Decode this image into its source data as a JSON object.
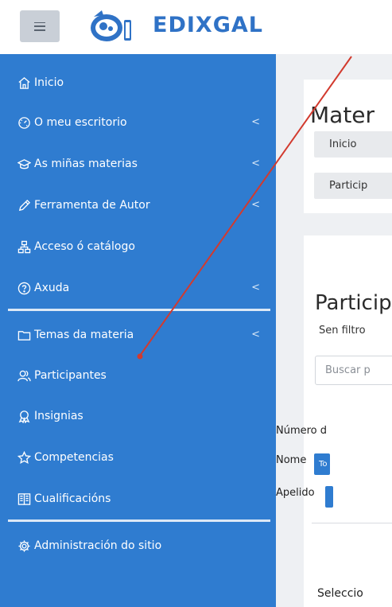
{
  "header": {
    "menu_icon": "hamburger-icon",
    "logo_icon": "edixgal-logo-icon",
    "logo_text": "EDIXGAL"
  },
  "sidebar": {
    "items": [
      {
        "label": "Inicio",
        "icon": "home-icon",
        "chevron": false
      },
      {
        "label": "O meu escritorio",
        "icon": "speedometer-icon",
        "chevron": true
      },
      {
        "label": "As miñas materias",
        "icon": "graduation-cap-icon",
        "chevron": true
      },
      {
        "label": "Ferramenta de Autor",
        "icon": "pencil-icon",
        "chevron": true
      },
      {
        "label": "Acceso ó catálogo",
        "icon": "sitemap-icon",
        "chevron": false
      },
      {
        "label": "Axuda",
        "icon": "help-circle-icon",
        "chevron": true
      },
      {
        "label": "Temas da materia",
        "icon": "folder-icon",
        "chevron": true
      },
      {
        "label": "Participantes",
        "icon": "users-icon",
        "chevron": false
      },
      {
        "label": "Insignias",
        "icon": "award-icon",
        "chevron": false
      },
      {
        "label": "Competencias",
        "icon": "star-icon",
        "chevron": false
      },
      {
        "label": "Cualificacións",
        "icon": "book-icon",
        "chevron": false
      },
      {
        "label": "Administración do sitio",
        "icon": "gear-icon",
        "chevron": false
      }
    ],
    "chevron_glyph": "<"
  },
  "main": {
    "header_card": {
      "title": "Mater",
      "breadcrumbs": [
        "Inicio",
        "Particip"
      ]
    },
    "participants_card": {
      "title": "Particip",
      "filter_status": "Sen filtro",
      "search_placeholder": "Buscar p",
      "count_label": "Número d",
      "name_label": "Nome",
      "name_chip": "To",
      "surname_label": "Apelido",
      "select_label": "Seleccio"
    }
  },
  "colors": {
    "sidebar_bg": "#2f7cd0",
    "logo_blue": "#2f72c6",
    "arrow_red": "#d23a2e",
    "main_bg": "#eef0f3"
  }
}
